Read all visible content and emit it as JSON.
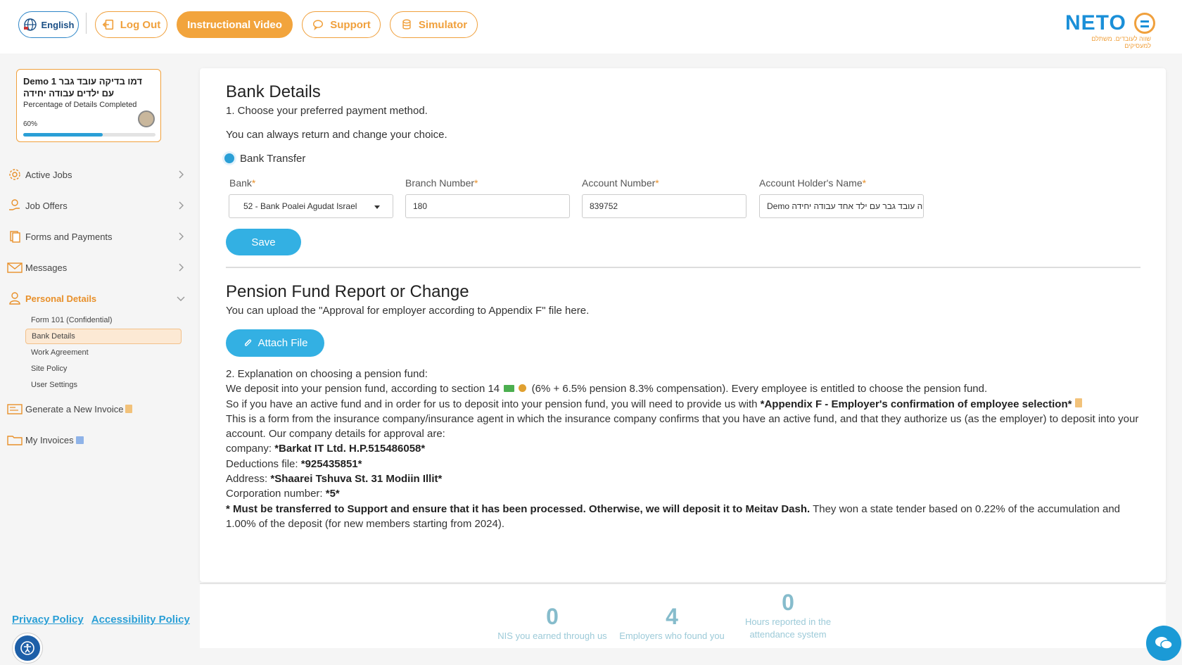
{
  "header": {
    "language": "English",
    "logout": "Log Out",
    "instructional_video": "Instructional Video",
    "support": "Support",
    "simulator": "Simulator",
    "logo_text": "NETO",
    "logo_tagline": "שווה לעובדים. משתלם למעסיקים",
    "accent_color": "#f0a03c",
    "brand_color": "#1a8fd8"
  },
  "profile": {
    "name": "Demo 1 דמו בדיקה עובד גבר עם ילדים עבודה יחידה",
    "completion_label": "Percentage of Details Completed",
    "completion_percent_text": "60%",
    "completion_fraction": 0.6
  },
  "sidebar": {
    "items": [
      {
        "label": "Active Jobs",
        "icon": "gear-icon"
      },
      {
        "label": "Job Offers",
        "icon": "hand-coin-icon"
      },
      {
        "label": "Forms and Payments",
        "icon": "documents-icon"
      },
      {
        "label": "Messages",
        "icon": "envelope-icon"
      },
      {
        "label": "Personal Details",
        "icon": "person-icon"
      }
    ],
    "sub_items": [
      "Form 101 (Confidential)",
      "Bank Details",
      "Work Agreement",
      "Site Policy",
      "User Settings"
    ],
    "extra_items": [
      {
        "label": "Generate a New Invoice",
        "icon": "invoice-icon"
      },
      {
        "label": "My Invoices",
        "icon": "folder-icon"
      }
    ],
    "privacy_policy": "Privacy Policy",
    "accessibility_policy": "Accessibility Policy"
  },
  "bank": {
    "title": "Bank Details",
    "step1": "1. Choose your preferred payment method.",
    "note": "You can always return and change your choice.",
    "method": "Bank Transfer",
    "bank_label": "Bank",
    "branch_label": "Branch Number",
    "account_label": "Account Number",
    "holder_label": "Account Holder's Name",
    "required_mark": "*",
    "bank_value": "52 - Bank Poalei Agudat Israel",
    "branch_value": "180",
    "account_value": "839752",
    "holder_value": "Demo דמו בדיקה עובד גבר עם ילד אחד עבודה יחידה",
    "save": "Save"
  },
  "pension": {
    "title": "Pension Fund Report or Change",
    "upload_text": "You can upload the \"Approval for employer according to Appendix F\" file here.",
    "attach": "Attach File",
    "explain_title": "2. Explanation on choosing a pension fund:",
    "line1a": "We deposit into your pension fund, according to section 14",
    "line1b": "(6% + 6.5% pension 8.3% compensation). Every employee is entitled to choose the pension fund.",
    "line2a": "So if you have an active fund and in order for us to deposit into your pension fund, you will need to provide us with ",
    "line2b": "*Appendix F - Employer's confirmation of employee selection*",
    "line3": "This is a form from the insurance company/insurance agent in which the insurance company confirms that you have an active fund, and that they authorize us (as the employer) to deposit into your account. Our company details for approval are:",
    "company_label": "company: ",
    "company_value": "*Barkat IT Ltd. H.P.515486058*",
    "deductions_label": "Deductions file: ",
    "deductions_value": "*925435851*",
    "address_label": "Address: ",
    "address_value": "*Shaarei Tshuva St. 31 Modiin Illit*",
    "corp_label": "Corporation number: ",
    "corp_value": "*5*",
    "warning_bold": "* Must be transferred to Support and ensure that it has been processed. Otherwise, we will deposit it to Meitav Dash.",
    "warning_rest": "  They won a state tender based on 0.22% of the accumulation and 1.00% of the deposit (for new members starting from 2024)."
  },
  "stats": [
    {
      "value": "0",
      "caption": "NIS you earned through us"
    },
    {
      "value": "4",
      "caption": "Employers who found you"
    },
    {
      "value": "0",
      "caption": "Hours reported in the attendance system"
    }
  ]
}
